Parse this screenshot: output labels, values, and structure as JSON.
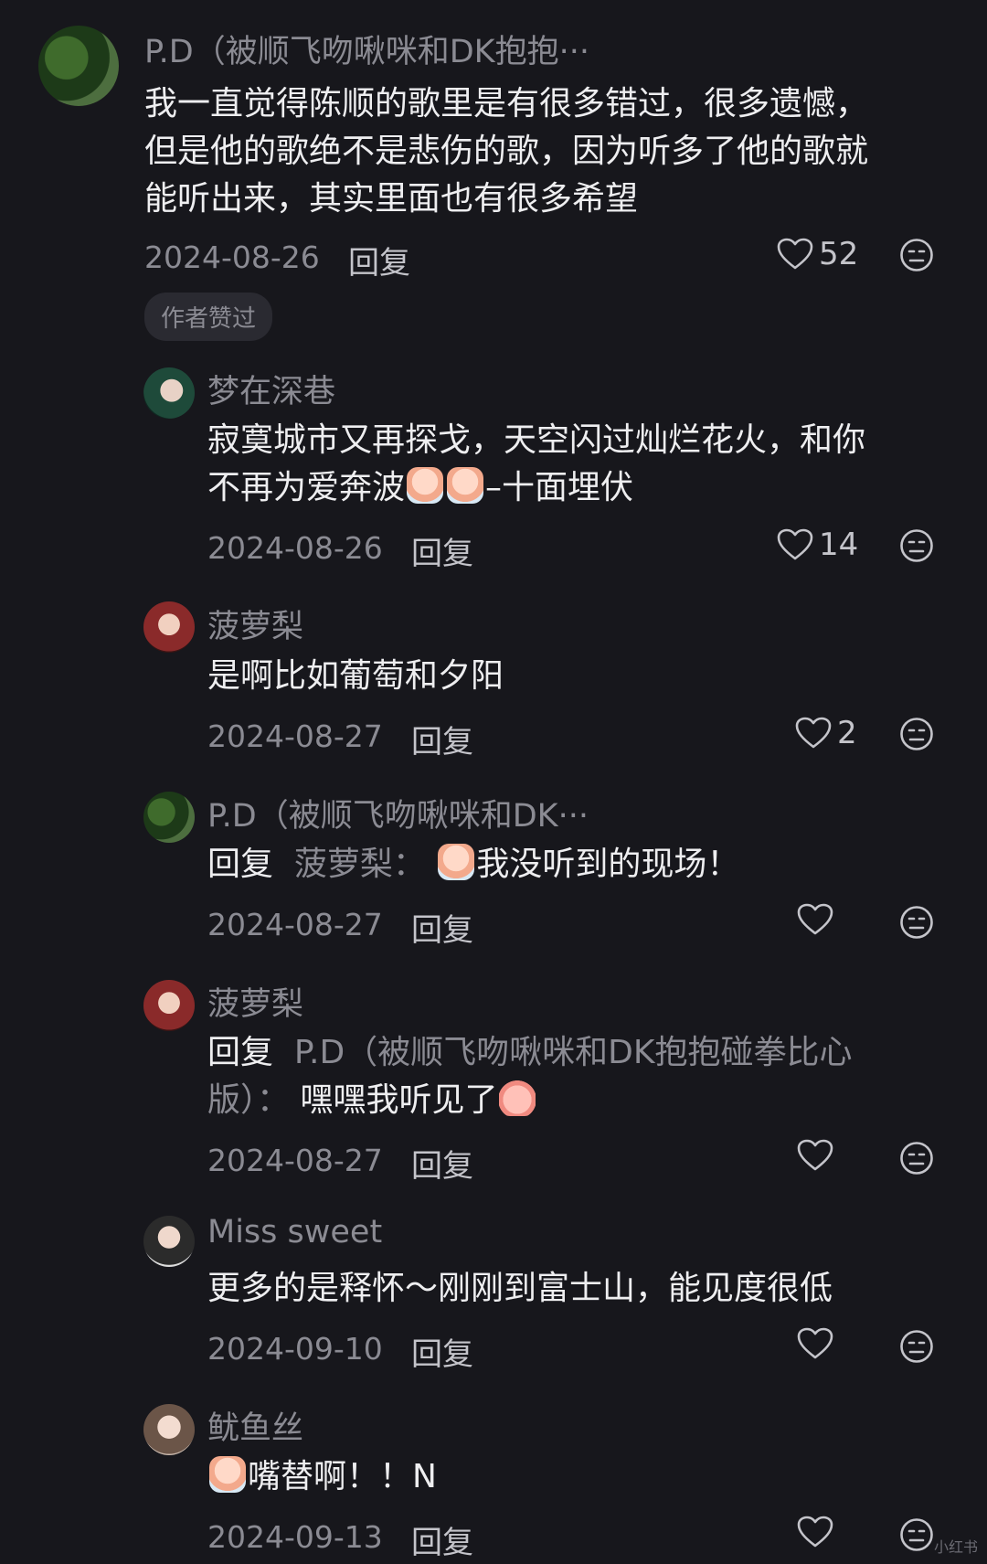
{
  "comments": [
    {
      "name": "P.D（被顺飞吻啾咪和DK抱抱···",
      "lines": [
        "我一直觉得陈顺的歌里是有很多错过，很多遗憾，",
        "但是他的歌绝不是悲伤的歌，因为听多了他的歌就",
        "能听出来，其实里面也有很多希望"
      ],
      "date": "2024-08-26",
      "reply": "回复",
      "likes": "52",
      "badge": "作者赞过"
    },
    {
      "name": "梦在深巷",
      "line1": "寂寞城市又再探戈，天空闪过灿烂花火，和你",
      "line2a": "不再为爱奔波",
      "line2b": "–十面埋伏",
      "date": "2024-08-26",
      "reply": "回复",
      "likes": "14"
    },
    {
      "name": "菠萝梨",
      "line1": "是啊比如葡萄和夕阳",
      "date": "2024-08-27",
      "reply": "回复",
      "likes": "2"
    },
    {
      "name": "P.D（被顺飞吻啾咪和DK···",
      "reply_prefix": "回复",
      "reply_target": "菠萝梨：",
      "line1": "我没听到的现场！",
      "date": "2024-08-27",
      "reply": "回复",
      "likes": ""
    },
    {
      "name": "菠萝梨",
      "reply_prefix": "回复",
      "reply_target": "P.D（被顺飞吻啾咪和DK抱抱碰拳比心",
      "reply_target2": "版）：",
      "line2": "嘿嘿我听见了",
      "date": "2024-08-27",
      "reply": "回复",
      "likes": ""
    },
    {
      "name": "Miss sweet",
      "line1": "更多的是释怀～刚刚到富士山，能见度很低",
      "date": "2024-09-10",
      "reply": "回复",
      "likes": ""
    },
    {
      "name": "鱿鱼丝",
      "line1": "嘴替啊！！N",
      "date": "2024-09-13",
      "reply": "回复",
      "likes": ""
    }
  ],
  "icons": {
    "like": "heart-outline-icon",
    "react": "emoji-face-icon",
    "inline_emoji": "crying-emoji",
    "peach_emoji": "peach-emoji"
  },
  "colors": {
    "background": "#17171c",
    "muted": "#8b8b93",
    "text": "#eeeef0"
  },
  "watermark": "小红书"
}
